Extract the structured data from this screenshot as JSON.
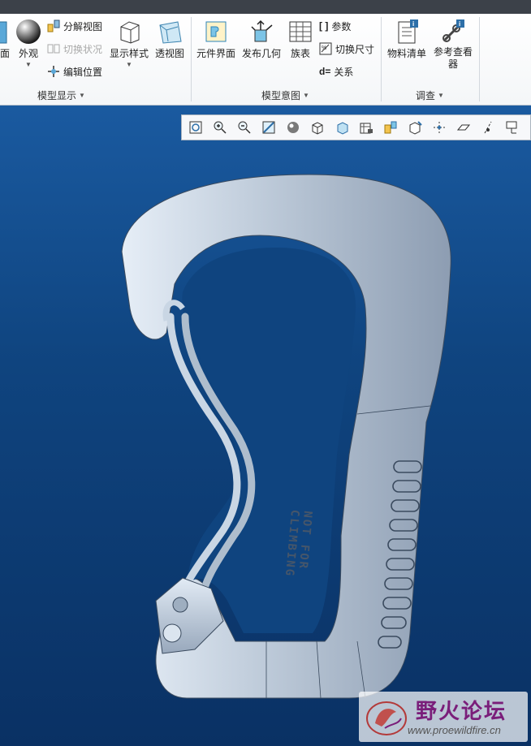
{
  "ribbon": {
    "groups": {
      "model_display": {
        "label": "模型显示",
        "partial_left_label": "面",
        "appearance": "外观",
        "explode_view": "分解视图",
        "toggle_status": "切换状况",
        "edit_position": "编辑位置",
        "display_style": "显示样式",
        "perspective_view": "透视图"
      },
      "model_intent": {
        "label": "模型意图",
        "component_interface": "元件界面",
        "publish_geometry": "发布几何",
        "family_table": "族表",
        "parameters": "参数",
        "switch_dimensions": "切换尺寸",
        "relations": "关系"
      },
      "investigate": {
        "label": "调查",
        "bill_of_materials": "物料清单",
        "reference_viewer": "参考查看器"
      }
    }
  },
  "view_toolbar": {
    "icons": [
      "refit-icon",
      "zoom-in-icon",
      "zoom-out-icon",
      "repaint-icon",
      "display-style-icon",
      "saved-orientations-icon",
      "named-views-icon",
      "view-manager-icon",
      "datum-display-icon",
      "annotation-display-icon",
      "spin-center-icon",
      "plane-display-icon",
      "axis-display-icon",
      "csys-display-icon"
    ]
  },
  "model": {
    "engraving": "NOT FOR CLIMBING"
  },
  "watermark": {
    "title": "野火论坛",
    "url": "www.proewildfire.cn"
  },
  "colors": {
    "viewport_top": "#1a5aa0",
    "viewport_bottom": "#0a3164",
    "model_metal": "#b8c6d6",
    "watermark_text": "#7a1e7a"
  }
}
